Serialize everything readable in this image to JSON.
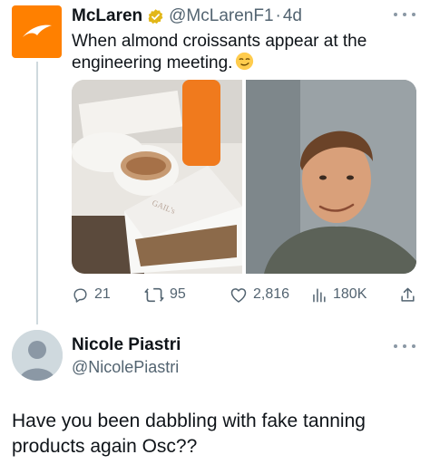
{
  "tweet": {
    "author_name": "McLaren",
    "author_handle": "@McLarenF1",
    "separator": "·",
    "time": "4d",
    "text": "When almond croissants appear at the engineering meeting.",
    "emoji": "smirking-face",
    "media_box_label": "GAIL's"
  },
  "actions": {
    "replies": "21",
    "retweets": "95",
    "likes": "2,816",
    "views": "180K"
  },
  "reply": {
    "author_name": "Nicole Piastri",
    "author_handle": "@NicolePiastri",
    "text": "Have you been dabbling with fake tanning products again Osc??"
  },
  "colors": {
    "brand_orange": "#ff8000",
    "verified_gold": "#e2b719",
    "secondary_text": "#536471"
  }
}
